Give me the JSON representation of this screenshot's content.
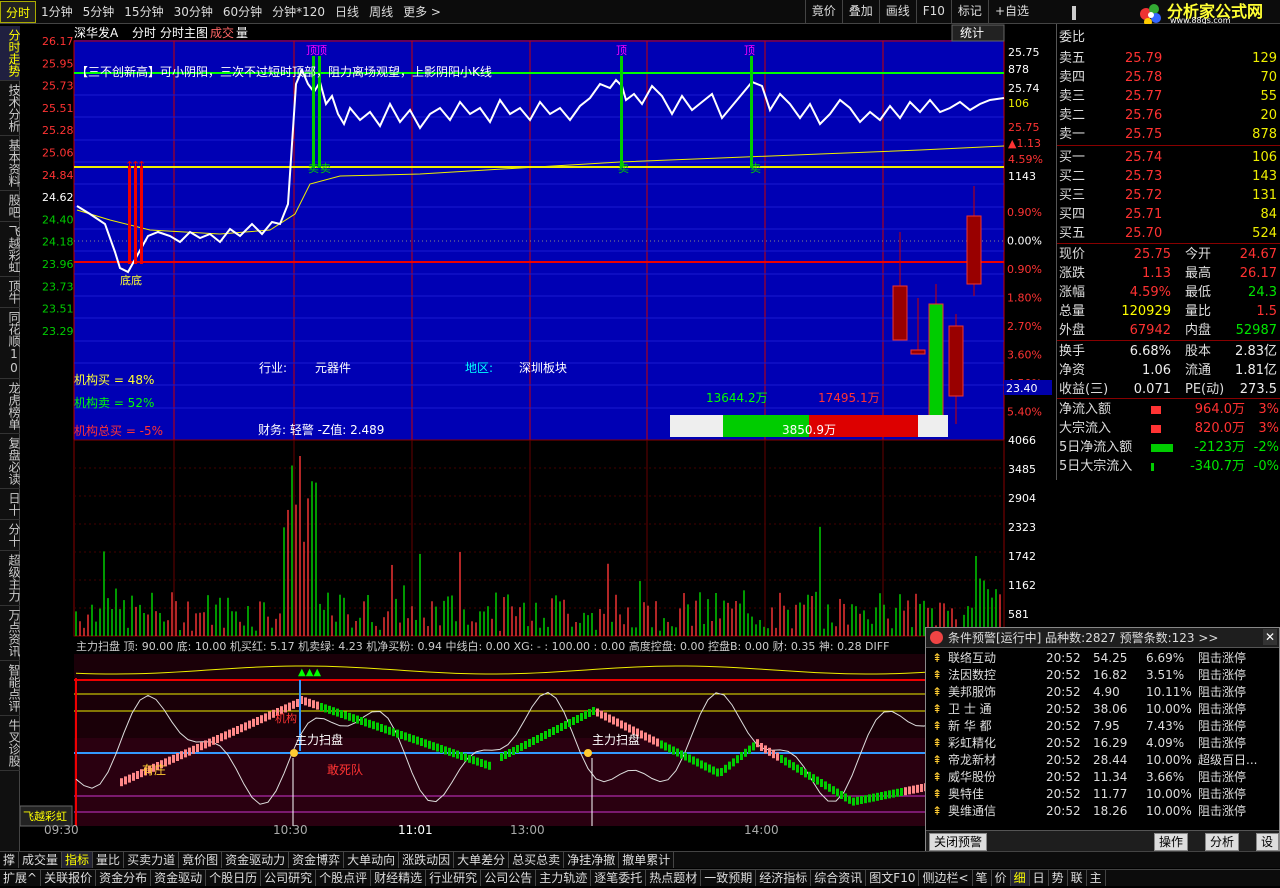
{
  "periods": [
    "分时",
    "1分钟",
    "5分钟",
    "15分钟",
    "30分钟",
    "60分钟",
    "分钟*120",
    "日线",
    "周线",
    "更多 >"
  ],
  "toolbar": [
    "竟价",
    "叠加",
    "画线",
    "F10",
    "标记",
    "+自选"
  ],
  "logo": {
    "text": "分析家公式网",
    "url": "www.88gs.com"
  },
  "leftnav": [
    "分时走势",
    "技术分析",
    "基本资料",
    "股吧",
    "飞越彩虹",
    "顶牛",
    "同花顺10",
    "龙虎榜单",
    "复盘必读",
    "日十",
    "分十",
    "超级主力",
    "万点资讯",
    "智能点评",
    "牛叉诊股"
  ],
  "leftnav_bottom": "飞越彩虹",
  "chart": {
    "stock": "深华发A",
    "view1": "分时",
    "view2": "分时主图",
    "view3a": "成交",
    "view3b": "量",
    "stats_btn": "统计",
    "notice": "【三不创新高】可小阴阳，三次不过短时顶部，阻力离场观望，上影阴阳小K线",
    "price_ticks": [
      "26.17",
      "25.95",
      "25.73",
      "25.51",
      "25.28",
      "25.06",
      "24.84",
      "24.62",
      "24.40",
      "24.18",
      "23.96",
      "23.73",
      "23.51",
      "23.29"
    ],
    "pct_ticks": [
      "0.90%",
      "0.00%",
      "0.90%",
      "1.80%",
      "2.70%",
      "3.60%",
      "4.50%",
      "5.40%"
    ],
    "right_top": [
      "25.75",
      "878",
      "25.74",
      "106",
      "25.75",
      "▲1.13",
      "4.59%",
      "1143"
    ],
    "tag_ding": "顶",
    "tag_mai": "卖",
    "tag_di": "底",
    "industry_label": "行业:",
    "industry": "元器件",
    "region_label": "地区:",
    "region": "深圳板块",
    "inst_buy": "机构买 = 48%",
    "inst_sell": "机构卖 = 52%",
    "inst_total": "机构总买 = -5%",
    "finance": "财务: 轻警   -Z值: 2.489",
    "flow_in": "13644.2万",
    "flow_out": "17495.1万",
    "flow_net": "3850.9万",
    "cursor_price": "23.40",
    "vol_ticks": [
      "4066",
      "3485",
      "2904",
      "2323",
      "1742",
      "1162",
      "581"
    ],
    "ind_line": "主力扫盘  顶: 90.00  底: 10.00  机买红: 5.17  机卖绿: 4.23  机净买粉: 0.94  中线白: 0.00  XG: - : 100.00 : 0.00  高度控盘: 0.00  控盘B: 0.00  财: 0.35  神: 0.28  DIFF",
    "ann_sweep": "主力扫盘",
    "ann_zhuang": "有庄",
    "ann_dare": "敢死队",
    "ann_jigou": "机构",
    "time_ticks": [
      "09:30",
      "10:30",
      "11:01",
      "13:00",
      "14:00"
    ]
  },
  "quote": {
    "header": "委比",
    "sell": [
      [
        "卖五",
        "25.79",
        "129"
      ],
      [
        "卖四",
        "25.78",
        "70"
      ],
      [
        "卖三",
        "25.77",
        "55"
      ],
      [
        "卖二",
        "25.76",
        "20"
      ],
      [
        "卖一",
        "25.75",
        "878"
      ]
    ],
    "buy": [
      [
        "买一",
        "25.74",
        "106"
      ],
      [
        "买二",
        "25.73",
        "143"
      ],
      [
        "买三",
        "25.72",
        "131"
      ],
      [
        "买四",
        "25.71",
        "84"
      ],
      [
        "买五",
        "25.70",
        "524"
      ]
    ],
    "stats": [
      [
        "现价",
        "25.75",
        "今开",
        "24.67"
      ],
      [
        "涨跌",
        "1.13",
        "最高",
        "26.17"
      ],
      [
        "涨幅",
        "4.59%",
        "最低",
        "24.3"
      ],
      [
        "总量",
        "120929",
        "量比",
        "1.5"
      ],
      [
        "外盘",
        "67942",
        "内盘",
        "52987"
      ]
    ],
    "stats2": [
      [
        "换手",
        "6.68%",
        "股本",
        "2.83亿"
      ],
      [
        "净资",
        "1.06",
        "流通",
        "1.81亿"
      ],
      [
        "收益(三)",
        "0.071",
        "PE(动)",
        "273.5"
      ]
    ],
    "flows": [
      [
        "净流入额",
        "964.0万",
        "3%"
      ],
      [
        "大宗流入",
        "820.0万",
        "3%"
      ],
      [
        "5日净流入额",
        "-2123万",
        "-2%"
      ],
      [
        "5日大宗流入",
        "-340.7万",
        "-0%"
      ]
    ]
  },
  "alert": {
    "title": "条件预警[运行中] 品种数:2827 预警条数:123  >>",
    "rows": [
      [
        "联络互动",
        "20:52",
        "54.25",
        "6.69%",
        "阻击涨停"
      ],
      [
        "法因数控",
        "20:52",
        "16.82",
        "3.51%",
        "阻击涨停"
      ],
      [
        "美邦服饰",
        "20:52",
        "4.90",
        "10.11%",
        "阻击涨停"
      ],
      [
        "卫 士 通",
        "20:52",
        "38.06",
        "10.00%",
        "阻击涨停"
      ],
      [
        "新 华 都",
        "20:52",
        "7.95",
        "7.43%",
        "阻击涨停"
      ],
      [
        "彩虹精化",
        "20:52",
        "16.29",
        "4.09%",
        "阻击涨停"
      ],
      [
        "帝龙新材",
        "20:52",
        "28.44",
        "10.00%",
        "超级百日..."
      ],
      [
        "威华股份",
        "20:52",
        "11.34",
        "3.66%",
        "阻击涨停"
      ],
      [
        "奥特佳",
        "20:52",
        "11.77",
        "10.00%",
        "阻击涨停"
      ],
      [
        "奥维通信",
        "20:52",
        "18.26",
        "10.00%",
        "阻击涨停"
      ]
    ],
    "btn_close": "关闭预警",
    "btn_op": "操作",
    "btn_an": "分析",
    "btn_set": "设置"
  },
  "bottom1": [
    "撑",
    "成交量",
    "指标",
    "量比",
    "买卖力道",
    "竟价图",
    "资金驱动力",
    "资金博弈",
    "大单动向",
    "涨跌动因",
    "大单差分",
    "总买总卖",
    "净挂净撤",
    "撤单累计"
  ],
  "bottom2": [
    "扩展^",
    "关联报价",
    "资金分布",
    "资金驱动",
    "个股日历",
    "公司研究",
    "个股点评",
    "财经精选",
    "行业研究",
    "公司公告",
    "主力轨迹",
    "逐笔委托",
    "热点题材",
    "一致预期",
    "经济指标",
    "综合资讯",
    "图文F10",
    "侧边栏<",
    "笔",
    "价",
    "细",
    "日",
    "势",
    "联",
    "主"
  ]
}
